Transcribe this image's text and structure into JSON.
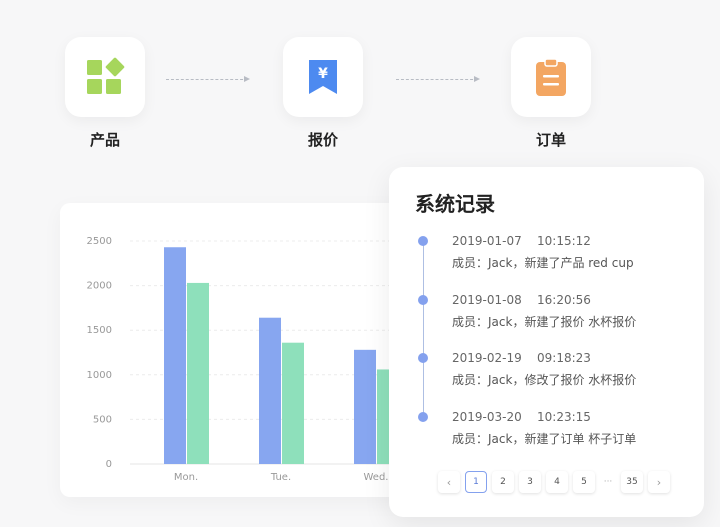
{
  "workflow": {
    "steps": [
      {
        "label": "产品",
        "icon": "product-grid-icon",
        "color": "#a6d65c"
      },
      {
        "label": "报价",
        "icon": "quote-yen-icon",
        "color": "#4d8af0",
        "symbol": "¥"
      },
      {
        "label": "订单",
        "icon": "clipboard-icon",
        "color": "#f3a662"
      }
    ]
  },
  "chart_data": {
    "type": "bar",
    "categories": [
      "Mon.",
      "Tue.",
      "Wed."
    ],
    "series": [
      {
        "values": [
          2430,
          1640,
          1280
        ],
        "color": "#87a6f0"
      },
      {
        "values": [
          2030,
          1360,
          1060
        ],
        "color": "#8ee0bb"
      }
    ],
    "yticks": [
      "0",
      "500",
      "1000",
      "1500",
      "2000",
      "2500"
    ],
    "ylim": [
      0,
      2500
    ],
    "grid": true
  },
  "log": {
    "title": "系统记录",
    "entries": [
      {
        "date": "2019-01-07",
        "time": "10:15:12",
        "text": "成员：Jack，新建了产品 red cup"
      },
      {
        "date": "2019-01-08",
        "time": "16:20:56",
        "text": "成员：Jack，新建了报价 水杯报价"
      },
      {
        "date": "2019-02-19",
        "time": "09:18:23",
        "text": "成员：Jack，修改了报价 水杯报价"
      },
      {
        "date": "2019-03-20",
        "time": "10:23:15",
        "text": "成员：Jack，新建了订单 杯子订单"
      }
    ]
  },
  "pagination": {
    "prev": "‹",
    "pages": [
      "1",
      "2",
      "3",
      "4",
      "5"
    ],
    "ellipsis": "···",
    "last": "35",
    "next": "›",
    "active": "1"
  }
}
